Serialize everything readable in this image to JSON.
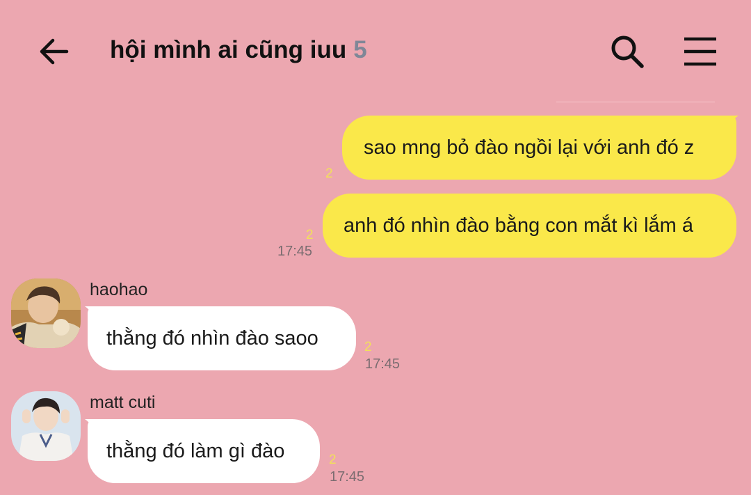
{
  "header": {
    "title": "hội mình ai cũng iuu",
    "member_count": "5",
    "back_icon": "arrow-left-icon",
    "search_icon": "search-icon",
    "menu_icon": "hamburger-menu-icon"
  },
  "colors": {
    "background": "#eca7b0",
    "outgoing_bubble": "#fae84a",
    "incoming_bubble": "#ffffff",
    "unread_count": "#f2e05a",
    "member_count": "#7f8797"
  },
  "messages": [
    {
      "direction": "outgoing",
      "text": "sao mng bỏ đào ngồi lại với anh đó z",
      "unread": "2",
      "time": ""
    },
    {
      "direction": "outgoing",
      "text": "anh đó nhìn đào bằng con mắt kì lắm á",
      "unread": "2",
      "time": "17:45"
    },
    {
      "direction": "incoming",
      "sender": "haohao",
      "text": "thằng đó nhìn đào saoo",
      "unread": "2",
      "time": "17:45"
    },
    {
      "direction": "incoming",
      "sender": "matt cuti",
      "text": "thằng đó làm gì đào",
      "unread": "2",
      "time": "17:45"
    }
  ]
}
